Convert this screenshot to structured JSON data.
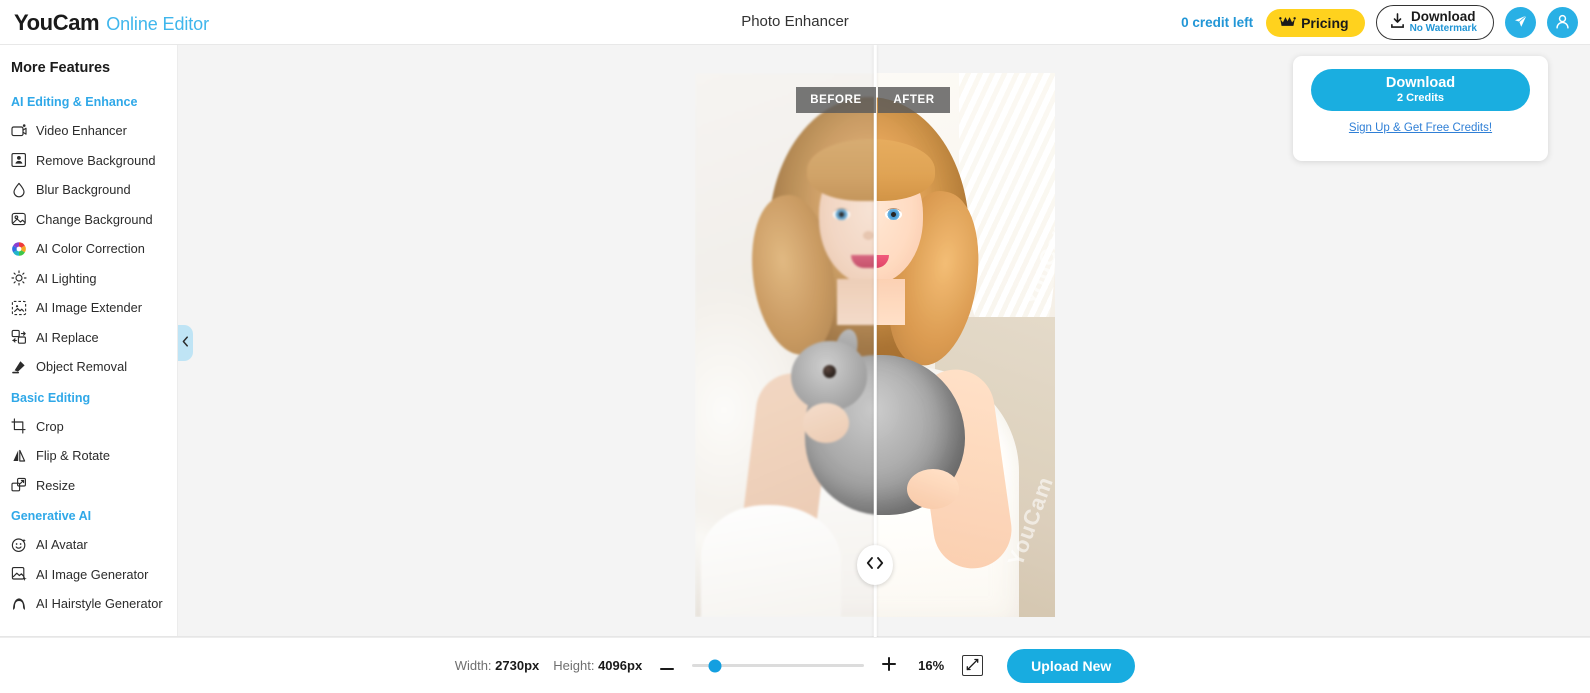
{
  "header": {
    "logo_brand": "YouCam",
    "logo_sub": "Online Editor",
    "page_title": "Photo Enhancer",
    "credit_left": "0 credit left",
    "pricing_label": "Pricing",
    "download_line1": "Download",
    "download_line2": "No Watermark",
    "send_icon": "send-icon",
    "account_icon": "user-avatar-icon",
    "crown_icon": "crown-icon",
    "accent_blue": "#29b0e5",
    "pricing_yellow": "#ffd21e"
  },
  "sidebar": {
    "title": "More Features",
    "collapse_icon": "chevron-left-icon",
    "groups": [
      {
        "label": "AI Editing & Enhance",
        "items": [
          {
            "label": "Video Enhancer",
            "icon": "video-enhancer-icon"
          },
          {
            "label": "Remove Background",
            "icon": "remove-background-icon"
          },
          {
            "label": "Blur Background",
            "icon": "blur-background-icon"
          },
          {
            "label": "Change Background",
            "icon": "change-background-icon"
          },
          {
            "label": "AI Color Correction",
            "icon": "color-wheel-icon"
          },
          {
            "label": "AI Lighting",
            "icon": "lighting-icon"
          },
          {
            "label": "AI Image Extender",
            "icon": "image-extender-icon"
          },
          {
            "label": "AI Replace",
            "icon": "ai-replace-icon"
          },
          {
            "label": "Object Removal",
            "icon": "object-removal-icon"
          }
        ]
      },
      {
        "label": "Basic Editing",
        "items": [
          {
            "label": "Crop",
            "icon": "crop-icon"
          },
          {
            "label": "Flip & Rotate",
            "icon": "flip-rotate-icon"
          },
          {
            "label": "Resize",
            "icon": "resize-icon"
          }
        ]
      },
      {
        "label": "Generative AI",
        "items": [
          {
            "label": "AI Avatar",
            "icon": "ai-avatar-icon"
          },
          {
            "label": "AI Image Generator",
            "icon": "ai-image-generator-icon"
          },
          {
            "label": "AI Hairstyle Generator",
            "icon": "ai-hairstyle-generator-icon"
          }
        ]
      }
    ]
  },
  "canvas": {
    "label_before": "BEFORE",
    "label_after": "AFTER",
    "watermark": "YouCam",
    "watermark2": "YouCam",
    "handle_icon": "compare-slider-handle-icon",
    "photo_description": "Young blonde girl in a white dress holding a gray rabbit"
  },
  "download_panel": {
    "button_line1": "Download",
    "button_line2": "2 Credits",
    "signup_link": "Sign Up & Get Free Credits!"
  },
  "footer": {
    "width_label": "Width:",
    "width_value": "2730px",
    "height_label": "Height:",
    "height_value": "4096px",
    "zoom_out_icon": "minus-icon",
    "zoom_in_icon": "plus-icon",
    "zoom_percent": "16%",
    "fit_icon": "fit-to-screen-icon",
    "upload_label": "Upload New"
  }
}
